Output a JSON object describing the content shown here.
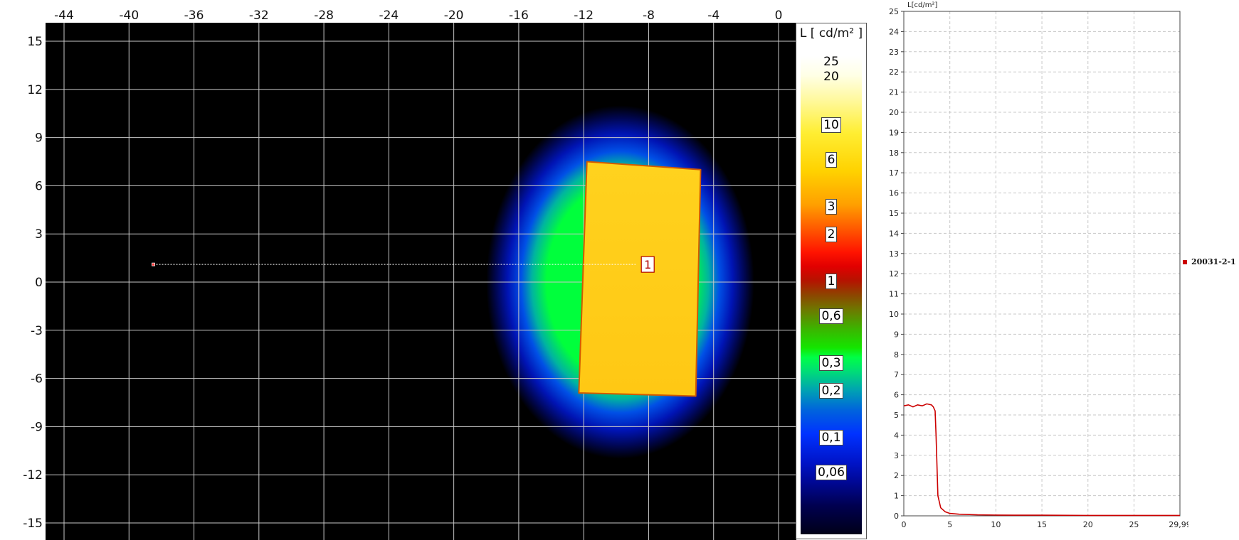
{
  "chart_data": [
    {
      "type": "heatmap",
      "x_ticks": [
        "-44",
        "-40",
        "-36",
        "-32",
        "-28",
        "-24",
        "-20",
        "-16",
        "-12",
        "-8",
        "-4",
        "0"
      ],
      "y_ticks": [
        "15",
        "12",
        "9",
        "6",
        "3",
        "0",
        "-3",
        "-6",
        "-9",
        "-12",
        "-15"
      ],
      "xlim": [
        -45,
        1
      ],
      "ylim": [
        -16,
        16
      ],
      "grid": true,
      "lit_region": {
        "corners": [
          [
            -11.8,
            7.5
          ],
          [
            -4.8,
            7.0
          ],
          [
            -5.1,
            -7.1
          ],
          [
            -12.3,
            -6.9
          ]
        ],
        "luminance": 5.5,
        "halo_extent": [
          -18,
          -1.5,
          -11,
          11
        ]
      },
      "measurement_line": {
        "start": [
          -38.5,
          1.1
        ],
        "end": [
          -8.8,
          1.1
        ],
        "marker": "1"
      }
    },
    {
      "type": "line",
      "ylabel": "L[cd/m²]",
      "x_ticks": [
        "0",
        "5",
        "10",
        "15",
        "20",
        "25",
        "29,99"
      ],
      "y_ticks": [
        "25",
        "24",
        "23",
        "22",
        "21",
        "20",
        "19",
        "18",
        "17",
        "16",
        "15",
        "14",
        "13",
        "12",
        "11",
        "10",
        "9",
        "8",
        "7",
        "6",
        "5",
        "4",
        "3",
        "2",
        "1",
        "0"
      ],
      "xlim": [
        0,
        29.99
      ],
      "ylim": [
        0,
        25
      ],
      "x_unit": "°",
      "grid": true,
      "legend": "right",
      "series": [
        {
          "name": "20031-2-1",
          "color": "#cc0000",
          "x": [
            0,
            0.5,
            1.0,
            1.5,
            2.0,
            2.5,
            3.0,
            3.2,
            3.4,
            3.5,
            3.6,
            3.7,
            4.0,
            4.5,
            5.0,
            6.0,
            8.0,
            10.0,
            12.0,
            15.0,
            20.0,
            25.0,
            29.99
          ],
          "y": [
            5.45,
            5.5,
            5.4,
            5.5,
            5.45,
            5.55,
            5.5,
            5.4,
            5.2,
            4.0,
            2.5,
            1.0,
            0.4,
            0.2,
            0.12,
            0.08,
            0.05,
            0.04,
            0.03,
            0.03,
            0.02,
            0.02,
            0.02
          ]
        }
      ]
    }
  ],
  "scale": {
    "title": "L [ cd/m² ]",
    "labels": [
      {
        "text": "25",
        "boxed": false
      },
      {
        "text": "20",
        "boxed": false
      },
      {
        "text": "10",
        "boxed": true
      },
      {
        "text": "6",
        "boxed": true
      },
      {
        "text": "3",
        "boxed": true
      },
      {
        "text": "2",
        "boxed": true
      },
      {
        "text": "1",
        "boxed": true
      },
      {
        "text": "0,6",
        "boxed": true
      },
      {
        "text": "0,3",
        "boxed": true
      },
      {
        "text": "0,2",
        "boxed": true
      },
      {
        "text": "0,1",
        "boxed": true
      },
      {
        "text": "0,06",
        "boxed": true
      }
    ]
  }
}
